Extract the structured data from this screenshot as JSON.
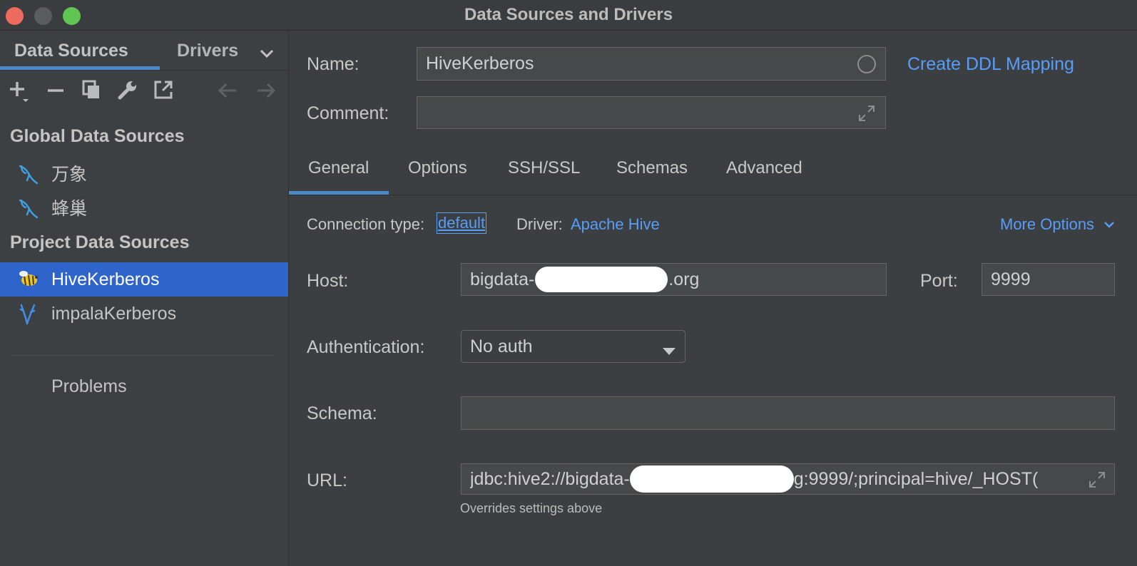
{
  "window": {
    "title": "Data Sources and Drivers"
  },
  "left_panel": {
    "tabs": [
      {
        "label": "Data Sources"
      },
      {
        "label": "Drivers"
      }
    ],
    "sections": {
      "global_label": "Global Data Sources",
      "global_items": [
        {
          "label": "万象"
        },
        {
          "label": "蜂巢"
        }
      ],
      "project_label": "Project Data Sources",
      "project_items": [
        {
          "label": "HiveKerberos",
          "selected": true
        },
        {
          "label": "impalaKerberos"
        }
      ]
    },
    "problems_label": "Problems"
  },
  "form": {
    "name_label": "Name:",
    "name_value": "HiveKerberos",
    "comment_label": "Comment:",
    "comment_value": "",
    "ddl_link": "Create DDL Mapping",
    "tabs": [
      {
        "label": "General"
      },
      {
        "label": "Options"
      },
      {
        "label": "SSH/SSL"
      },
      {
        "label": "Schemas"
      },
      {
        "label": "Advanced"
      }
    ],
    "connection_type_label": "Connection type:",
    "connection_type_value": "default",
    "driver_label": "Driver:",
    "driver_value": "Apache Hive",
    "more_options": "More Options",
    "host_label": "Host:",
    "host_prefix": "bigdata-",
    "host_suffix": ".org",
    "port_label": "Port:",
    "port_value": "9999",
    "auth_label": "Authentication:",
    "auth_value": "No auth",
    "schema_label": "Schema:",
    "schema_value": "",
    "url_label": "URL:",
    "url_prefix": "jdbc:hive2://bigdata-",
    "url_suffix": "g:9999/;principal=hive/_HOST(",
    "url_hint": "Overrides settings above"
  },
  "colors": {
    "accent": "#4a88c7",
    "link": "#589df6",
    "selection": "#2f65ca",
    "close": "#ed6a5e",
    "minimize": "#5a5a5a",
    "maximize": "#61c554"
  }
}
